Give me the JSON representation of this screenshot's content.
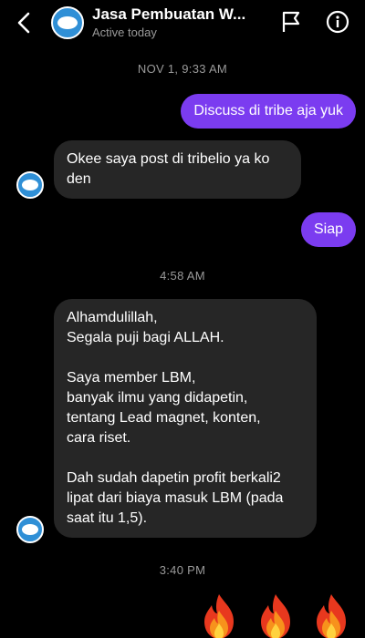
{
  "header": {
    "title": "Jasa Pembuatan W...",
    "status": "Active today",
    "back_icon": "chevron-left-icon",
    "flag_icon": "flag-icon",
    "info_icon": "info-icon"
  },
  "timestamps": [
    "NOV 1, 9:33 AM",
    "4:58 AM",
    "3:40 PM"
  ],
  "messages": [
    {
      "from": "me",
      "lines": [
        "Discuss di tribe aja yuk"
      ]
    },
    {
      "from": "them",
      "lines": [
        "Okee saya post di tribelio ya ko",
        "den"
      ]
    },
    {
      "from": "me",
      "lines": [
        "Siap"
      ]
    },
    {
      "from": "them",
      "lines": [
        "Alhamdulillah,",
        "Segala puji bagi ALLAH.",
        "",
        "Saya member LBM,",
        "banyak ilmu yang didapetin,",
        "tentang Lead magnet, konten,",
        "cara riset.",
        "",
        "Dah sudah dapetin profit berkali2",
        "lipat dari biaya masuk LBM (pada",
        "saat itu 1,5)."
      ]
    }
  ],
  "reaction_emojis": [
    "🔥",
    "🔥",
    "🔥"
  ],
  "colors": {
    "background": "#000000",
    "outgoing_bubble": "#7b3cf0",
    "incoming_bubble": "#262626",
    "avatar": "#2f8fd6",
    "muted_text": "#9a9a9a"
  }
}
